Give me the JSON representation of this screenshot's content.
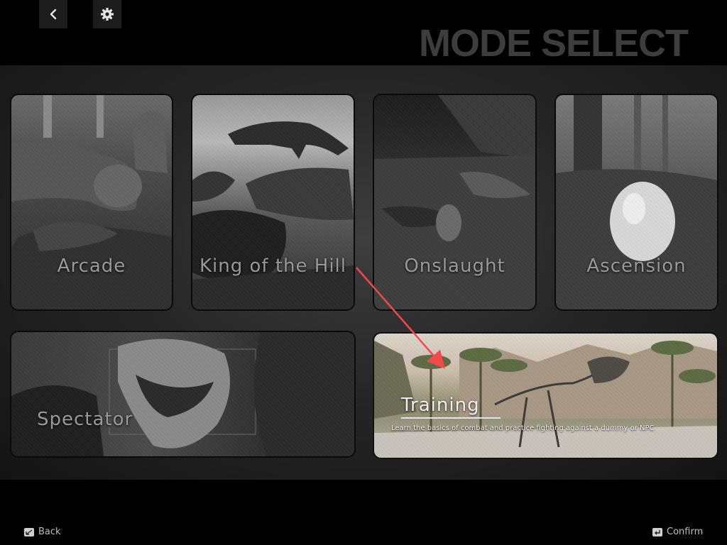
{
  "header": {
    "title": "MODE SELECT",
    "back_icon": "chevron-left-icon",
    "settings_icon": "gear-icon"
  },
  "modes": [
    {
      "id": "arcade",
      "label": "Arcade"
    },
    {
      "id": "king-of-the-hill",
      "label": "King of the Hill"
    },
    {
      "id": "onslaught",
      "label": "Onslaught"
    },
    {
      "id": "ascension",
      "label": "Ascension"
    },
    {
      "id": "spectator",
      "label": "Spectator"
    },
    {
      "id": "training",
      "label": "Training",
      "description": "Learn the basics of combat and practice fighting against a dummy or NPC",
      "selected": true
    }
  ],
  "footer": {
    "back_label": "Back",
    "confirm_label": "Confirm",
    "back_icon": "keyboard-back-icon",
    "confirm_icon": "enter-key-icon"
  },
  "colors": {
    "background": "#000000",
    "panel": "#2a2a2a",
    "title": "#3d3d3d",
    "annotation_arrow": "#f04a4a"
  }
}
